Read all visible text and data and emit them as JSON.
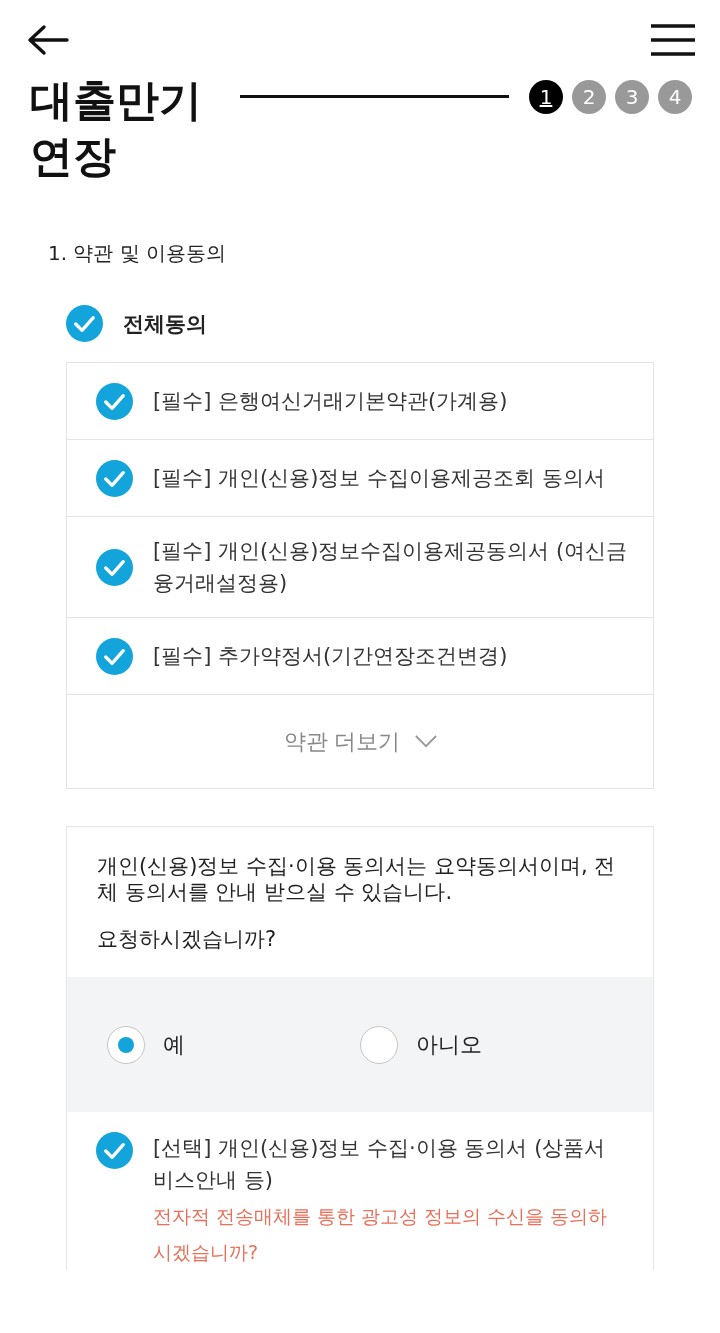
{
  "header": {
    "title": "대출만기 연장"
  },
  "steps": [
    {
      "label": "1",
      "selected": true
    },
    {
      "label": "2",
      "selected": false
    },
    {
      "label": "3",
      "selected": false
    },
    {
      "label": "4",
      "selected": false
    }
  ],
  "section": {
    "heading": "1. 약관 및 이용동의"
  },
  "agree_all": {
    "label": "전체동의",
    "checked": true
  },
  "terms": [
    {
      "label": "[필수] 은행여신거래기본약관(가계용)",
      "checked": true
    },
    {
      "label": "[필수] 개인(신용)정보 수집이용제공조회 동의서",
      "checked": true
    },
    {
      "label": "[필수] 개인(신용)정보수집이용제공동의서 (여신금융거래설정용)",
      "checked": true
    },
    {
      "label": "[필수] 추가약정서(기간연장조건변경)",
      "checked": true
    }
  ],
  "more_button": {
    "label": "약관 더보기"
  },
  "notice": {
    "text": "개인(신용)정보 수집·이용 동의서는 요약동의서이며, 전체 동의서를 안내 받으실 수 있습니다.",
    "question": "요청하시겠습니까?",
    "options": [
      {
        "label": "예",
        "selected": true
      },
      {
        "label": "아니오",
        "selected": false
      }
    ]
  },
  "optional": {
    "label": "[선택] 개인(신용)정보 수집·이용 동의서 (상품서비스안내 등)",
    "checked": true,
    "note": "전자적 전송매체를 통한 광고성 정보의 수신을 동의하시겠습니까?"
  }
}
